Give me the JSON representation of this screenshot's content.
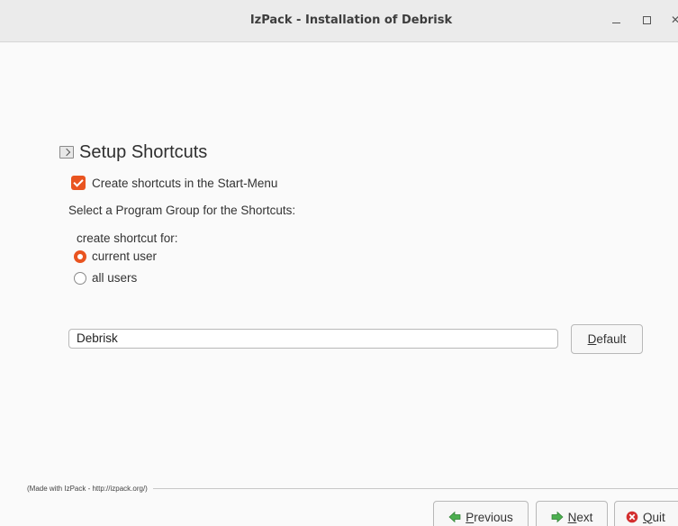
{
  "window": {
    "title": "IzPack - Installation of Debrisk"
  },
  "panel": {
    "heading": "Setup Shortcuts",
    "create_shortcuts_label": "Create shortcuts in the Start-Menu",
    "create_shortcuts_checked": true,
    "program_group_label": "Select a Program Group for the Shortcuts:",
    "create_for_label": "create shortcut for:",
    "radio_options": [
      {
        "label": "current user",
        "selected": true
      },
      {
        "label": "all users",
        "selected": false
      }
    ],
    "program_group_value": "Debrisk",
    "default_button_label": "efault",
    "default_button_mnemonic": "D"
  },
  "footer": {
    "credit": "(Made with IzPack - http://izpack.org/)",
    "previous_mnemonic": "P",
    "previous_rest": "revious",
    "next_mnemonic": "N",
    "next_rest": "ext",
    "quit_mnemonic": "Q",
    "quit_rest": "uit"
  },
  "icons": {
    "heading": "shortcut-icon",
    "previous": "arrow-left-icon",
    "next": "arrow-right-icon",
    "quit": "quit-icon"
  },
  "colors": {
    "accent": "#e95420",
    "nav_arrow": "#4caf50",
    "quit": "#d32f2f"
  }
}
